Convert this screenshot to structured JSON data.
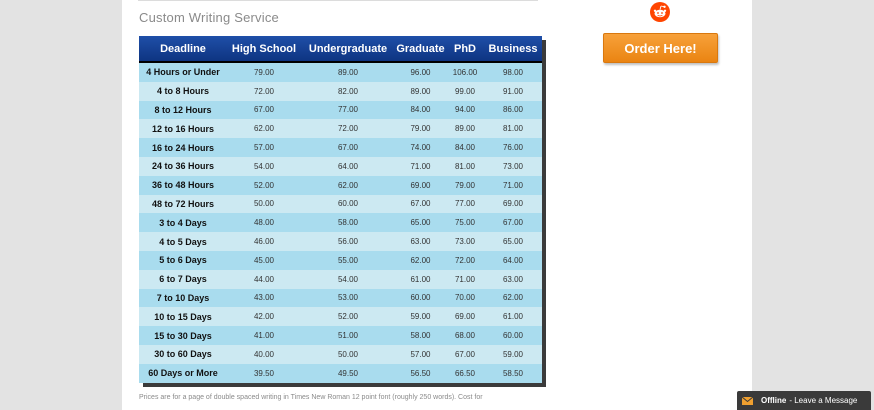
{
  "section": {
    "heading": "Custom Writing Service"
  },
  "social": {
    "icon": "reddit-icon",
    "color": "#ff4500"
  },
  "order_button": {
    "label": "Order Here!",
    "color": "#ee8a17"
  },
  "price_table": {
    "headers": [
      "Deadline",
      "High School",
      "Undergraduate",
      "Graduate",
      "PhD",
      "Business"
    ],
    "rows": [
      [
        "4 Hours or Under",
        "79.00",
        "89.00",
        "96.00",
        "106.00",
        "98.00"
      ],
      [
        "4 to 8 Hours",
        "72.00",
        "82.00",
        "89.00",
        "99.00",
        "91.00"
      ],
      [
        "8 to 12 Hours",
        "67.00",
        "77.00",
        "84.00",
        "94.00",
        "86.00"
      ],
      [
        "12 to 16 Hours",
        "62.00",
        "72.00",
        "79.00",
        "89.00",
        "81.00"
      ],
      [
        "16 to 24 Hours",
        "57.00",
        "67.00",
        "74.00",
        "84.00",
        "76.00"
      ],
      [
        "24 to 36 Hours",
        "54.00",
        "64.00",
        "71.00",
        "81.00",
        "73.00"
      ],
      [
        "36 to 48 Hours",
        "52.00",
        "62.00",
        "69.00",
        "79.00",
        "71.00"
      ],
      [
        "48 to 72 Hours",
        "50.00",
        "60.00",
        "67.00",
        "77.00",
        "69.00"
      ],
      [
        "3 to 4 Days",
        "48.00",
        "58.00",
        "65.00",
        "75.00",
        "67.00"
      ],
      [
        "4 to 5 Days",
        "46.00",
        "56.00",
        "63.00",
        "73.00",
        "65.00"
      ],
      [
        "5 to 6 Days",
        "45.00",
        "55.00",
        "62.00",
        "72.00",
        "64.00"
      ],
      [
        "6 to 7 Days",
        "44.00",
        "54.00",
        "61.00",
        "71.00",
        "63.00"
      ],
      [
        "7 to 10 Days",
        "43.00",
        "53.00",
        "60.00",
        "70.00",
        "62.00"
      ],
      [
        "10 to 15 Days",
        "42.00",
        "52.00",
        "59.00",
        "69.00",
        "61.00"
      ],
      [
        "15 to 30 Days",
        "41.00",
        "51.00",
        "58.00",
        "68.00",
        "60.00"
      ],
      [
        "30 to 60 Days",
        "40.00",
        "50.00",
        "57.00",
        "67.00",
        "59.00"
      ],
      [
        "60 Days or More",
        "39.50",
        "49.50",
        "56.50",
        "66.50",
        "58.50"
      ]
    ],
    "header_color": "#1a4aa0",
    "row_colors": [
      "#a9dcee",
      "#cce9f2"
    ]
  },
  "footnote": "Prices are for a page of double spaced writing in Times New Roman 12 point font (roughly 250 words). Cost for",
  "chat_widget": {
    "icon": "mail-icon",
    "status": "Offline",
    "label": "- Leave a Message"
  }
}
